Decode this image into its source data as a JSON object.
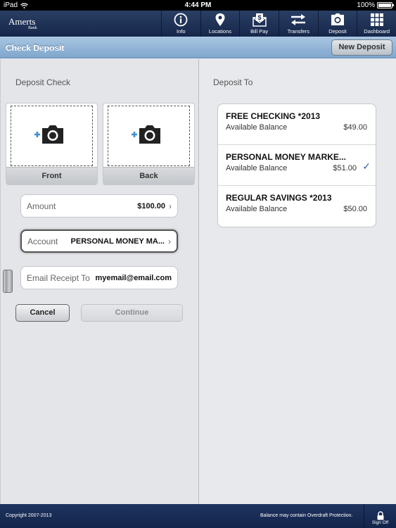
{
  "status_bar": {
    "device": "iPad",
    "time": "4:44 PM",
    "battery": "100%"
  },
  "brand": {
    "name": "Amerts",
    "sub": "Bank"
  },
  "nav": [
    {
      "label": "Info",
      "icon": "info-icon"
    },
    {
      "label": "Locations",
      "icon": "location-pin-icon"
    },
    {
      "label": "Bill Pay",
      "icon": "bill-pay-icon"
    },
    {
      "label": "Transfers",
      "icon": "transfers-icon"
    },
    {
      "label": "Deposit",
      "icon": "camera-icon"
    },
    {
      "label": "Dashboard",
      "icon": "grid-icon"
    }
  ],
  "header": {
    "title": "Check Deposit",
    "new_deposit": "New Deposit"
  },
  "left": {
    "section_title": "Deposit Check",
    "front_label": "Front",
    "back_label": "Back",
    "amount_label": "Amount",
    "amount_value": "$100.00",
    "account_label": "Account",
    "account_value": "PERSONAL MONEY MA...",
    "email_label": "Email Receipt To",
    "email_value": "myemail@email.com",
    "cancel": "Cancel",
    "continue": "Continue"
  },
  "right": {
    "section_title": "Deposit To",
    "accounts": [
      {
        "name": "FREE CHECKING *2013",
        "balance_label": "Available Balance",
        "balance": "$49.00",
        "selected": false
      },
      {
        "name": "PERSONAL MONEY MARKE...",
        "balance_label": "Available Balance",
        "balance": "$51.00",
        "selected": true
      },
      {
        "name": "REGULAR SAVINGS *2013",
        "balance_label": "Available Balance",
        "balance": "$50.00",
        "selected": false
      }
    ]
  },
  "footer": {
    "copyright": "Copyright 2007-2013",
    "note": "Balance may contain Overdraft Protection.",
    "sign_off": "Sign Off"
  },
  "colors": {
    "nav_bg": "#1c2f55",
    "title_bar": "#93b5d8",
    "accent_plus": "#3a8fd6",
    "check": "#3d5f98"
  }
}
